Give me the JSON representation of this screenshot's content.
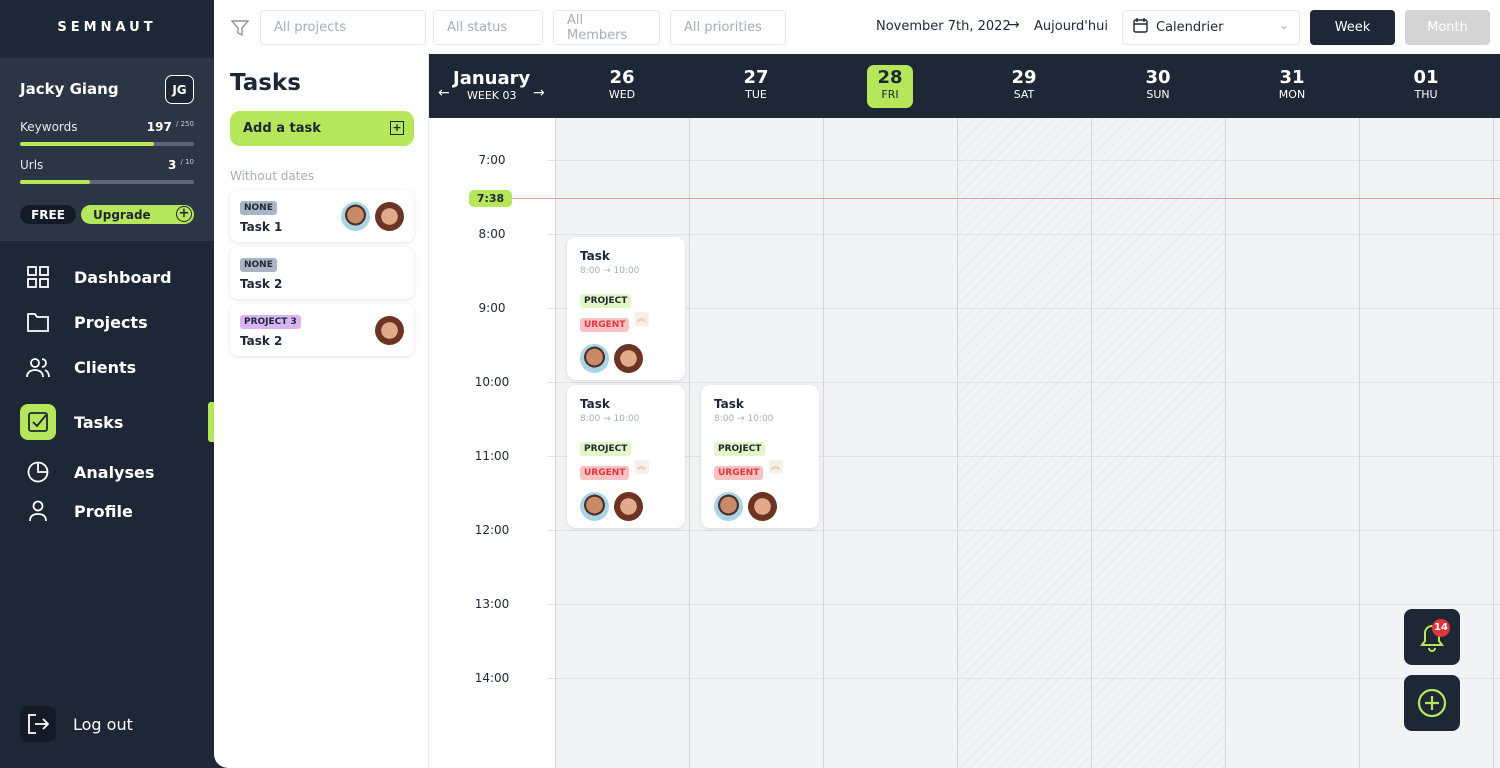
{
  "brand": "SEMNAUT",
  "user": {
    "name": "Jacky Giang",
    "initials": "JG",
    "plan": "FREE",
    "upgrade": "Upgrade",
    "keywords": {
      "label": "Keywords",
      "used": "197",
      "max": "/ 250",
      "fraction": 0.788
    },
    "urls": {
      "label": "Urls",
      "used": "3",
      "max": "/ 10",
      "fraction": 0.4
    }
  },
  "nav": [
    {
      "label": "Dashboard",
      "icon": "grid-icon"
    },
    {
      "label": "Projects",
      "icon": "folder-icon"
    },
    {
      "label": "Clients",
      "icon": "users-icon"
    },
    {
      "label": "Tasks",
      "icon": "checkbox-icon",
      "active": true
    },
    {
      "label": "Analyses",
      "icon": "pie-chart-icon"
    },
    {
      "label": "Profile",
      "icon": "user-icon"
    }
  ],
  "logout": "Log out",
  "filters": {
    "projects": "All projects",
    "status": "All status",
    "members": "All Members",
    "priorities": "All priorities"
  },
  "date": "November 7th, 2022",
  "today": "Aujourd'hui",
  "view_select": "Calendrier",
  "week": "Week",
  "month": "Month",
  "tasks": {
    "title": "Tasks",
    "add": "Add a task",
    "section": "Without dates",
    "items": [
      {
        "tag": "NONE",
        "name": "Task 1"
      },
      {
        "tag": "NONE",
        "name": "Task 2"
      },
      {
        "tag": "PROJECT 3",
        "name": "Task 2"
      }
    ]
  },
  "calendar": {
    "month": "January",
    "week": "WEEK 03",
    "days": [
      {
        "num": "26",
        "name": "WED"
      },
      {
        "num": "27",
        "name": "TUE"
      },
      {
        "num": "28",
        "name": "FRI",
        "today": true
      },
      {
        "num": "29",
        "name": "SAT"
      },
      {
        "num": "30",
        "name": "SUN"
      },
      {
        "num": "31",
        "name": "MON"
      },
      {
        "num": "01",
        "name": "THU"
      }
    ],
    "hours": [
      "7:00",
      "8:00",
      "9:00",
      "10:00",
      "11:00",
      "12:00",
      "13:00",
      "14:00"
    ],
    "now": "7:38",
    "events": [
      {
        "title": "Task",
        "time": "8:00 → 10:00",
        "project": "PROJECT",
        "priority": "URGENT"
      },
      {
        "title": "Task",
        "time": "8:00 → 10:00",
        "project": "PROJECT",
        "priority": "URGENT"
      },
      {
        "title": "Task",
        "time": "8:00 → 10:00",
        "project": "PROJECT",
        "priority": "URGENT"
      }
    ]
  },
  "notifications": "14",
  "colors": {
    "accent": "#b6e65a",
    "dark": "#1e2736",
    "urgent": "#e0353d"
  }
}
